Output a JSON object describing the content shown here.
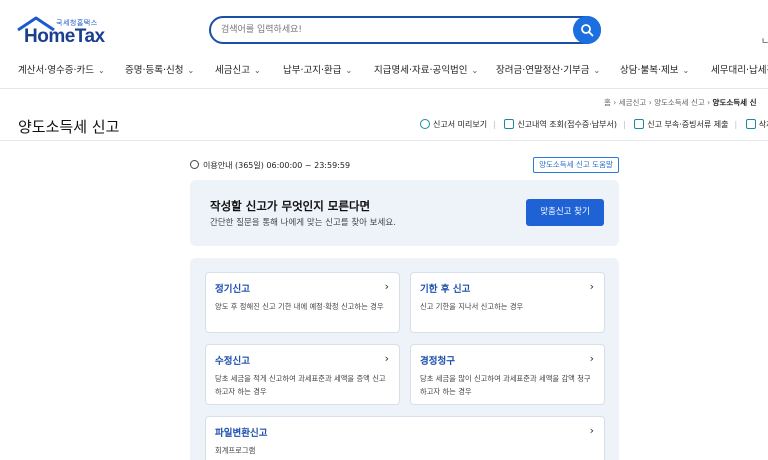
{
  "header": {
    "logo_sub": "국세청홈택스",
    "logo_main": "HomeTax",
    "search_placeholder": "검색어를 입력하세요!",
    "right_glyph": "ㄴ"
  },
  "nav": [
    {
      "label": "계산서·영수증·카드"
    },
    {
      "label": "증명·등록·신청"
    },
    {
      "label": "세금신고"
    },
    {
      "label": "납부·고지·환급"
    },
    {
      "label": "지급명세·자료·공익법인"
    },
    {
      "label": "장려금·연말정산·기부금"
    },
    {
      "label": "상담·불복·제보"
    },
    {
      "label": "세무대리·납세관"
    }
  ],
  "breadcrumb": {
    "home": "홈",
    "level1": "세금신고",
    "level2": "양도소득세 신고",
    "current": "양도소득세 신"
  },
  "page": {
    "title": "양도소득세 신고"
  },
  "actions": [
    {
      "label": "신고서 미리보기"
    },
    {
      "label": "신고내역 조회(접수증·납부서)"
    },
    {
      "label": "신고 부속·증빙서류 제출"
    },
    {
      "label": "삭제내역"
    }
  ],
  "usage": {
    "text": "이용안내 (365일) 06:00:00 ~ 23:59:59",
    "help_button": "양도소득세 신고 도움말"
  },
  "banner": {
    "heading": "작성할 신고가 무엇인지 모른다면",
    "desc": "간단한 질문을 통해 나에게 맞는 신고를 찾아 보세요.",
    "button": "맞춤신고 찾기"
  },
  "cards": [
    {
      "title": "정기신고",
      "desc": "양도 후 정해진 신고 기한 내에 예정·확정 신고하는 경우"
    },
    {
      "title": "기한 후 신고",
      "desc": "신고 기한을 지나서 신고하는 경우"
    },
    {
      "title": "수정신고",
      "desc": "당초 세금을 적게 신고하여 과세표준과 세액을 증액 신고하고자 하는 경우"
    },
    {
      "title": "경정청구",
      "desc": "당초 세금을 많이 신고하여 과세표준과 세액을 감액 청구하고자 하는 경우"
    },
    {
      "title": "파일변환신고",
      "desc": "회계프로그램"
    }
  ],
  "colors": {
    "brand": "#1a3f8f",
    "primary_button": "#1f62d6",
    "card_title": "#1d4fae",
    "panel_bg": "#eef3f9"
  }
}
